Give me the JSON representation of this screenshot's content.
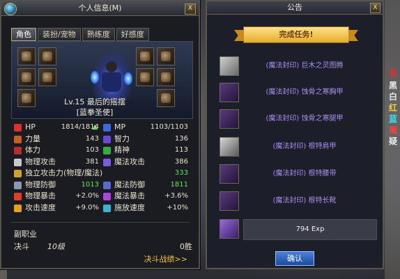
{
  "char_panel": {
    "title": "个人信息(M)",
    "close_label": "X",
    "tabs": [
      "角色",
      "装扮/宠物",
      "熟练度",
      "好感度"
    ],
    "level_name": "Lv.15 最后的摇摆",
    "job": "[蓝拳圣使]",
    "stats": {
      "hp_label": "HP",
      "hp_val": "1814/1814",
      "mp_label": "MP",
      "mp_val": "1103/1103",
      "str_label": "力量",
      "str_val": "143",
      "int_label": "智力",
      "int_val": "136",
      "vit_label": "体力",
      "vit_val": "103",
      "spr_label": "精神",
      "spr_val": "113",
      "patk_label": "物理攻击",
      "patk_val": "381",
      "matk_label": "魔法攻击",
      "matk_val": "386",
      "indep_label": "独立攻击力(物理/魔法)",
      "indep_val": "333",
      "pdef_label": "物理防御",
      "pdef_val": "1013",
      "mdef_label": "魔法防御",
      "mdef_val": "1811",
      "pcrit_label": "物理暴击",
      "pcrit_val": "+2.0%",
      "mcrit_label": "魔法暴击",
      "mcrit_val": "+3.6%",
      "aspd_label": "攻击速度",
      "aspd_val": "+9.0%",
      "cspd_label": "施放速度",
      "cspd_val": "+10%"
    },
    "sub_job_label": "副职业",
    "duel_label": "决斗",
    "duel_level": "10级",
    "duel_wins": "0胜",
    "duel_link": "决斗战绩>>"
  },
  "notice_panel": {
    "title": "公告",
    "close_label": "X",
    "banner": "完成任务!",
    "quests": [
      "(魔法封印) 巨木之灵图腾",
      "(魔法封印) 蚀骨之寒胸甲",
      "(魔法封印) 蚀骨之寒腿甲",
      "(魔法封印) 根特肩甲",
      "(魔法封印) 根特腰带",
      "(魔法封印) 根特长靴"
    ],
    "exp_reward": "794 Exp",
    "confirm_label": "确认"
  },
  "side_text": [
    "收",
    "黑",
    "白",
    "红",
    "蓝",
    "魔",
    "疑"
  ],
  "colors": {
    "quest_text": "#a98bf4",
    "positive_value": "#62e35a",
    "link": "#f2c13d",
    "accent_button": "#2e62c2"
  }
}
